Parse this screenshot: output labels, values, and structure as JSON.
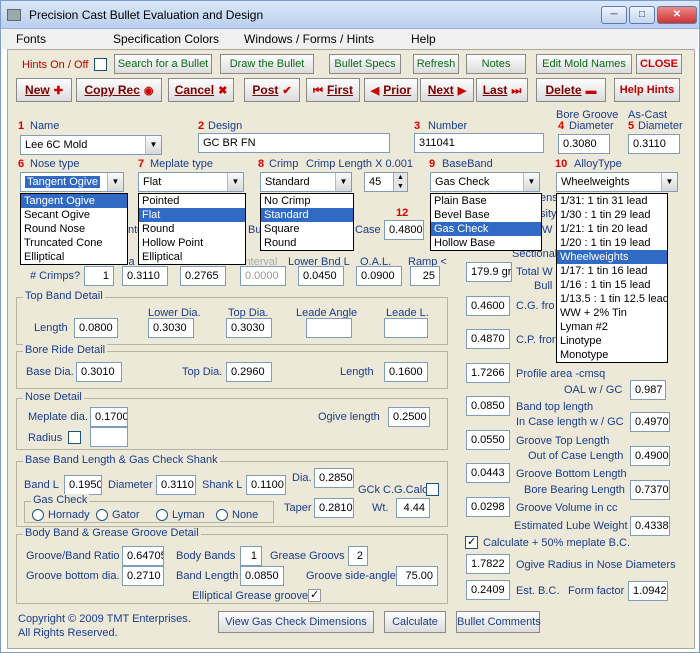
{
  "window": {
    "title": "Precision Cast Bullet Evaluation and Design"
  },
  "menu": [
    "Fonts",
    "Specification Colors",
    "Windows / Forms / Hints",
    "Help"
  ],
  "toolbar1": {
    "hints": "Hints On / Off",
    "search": "Search for a Bullet",
    "draw": "Draw the Bullet",
    "specs": "Bullet Specs",
    "refresh": "Refresh",
    "notes": "Notes",
    "mold": "Edit Mold Names",
    "close": "CLOSE"
  },
  "toolbar2": {
    "new": "New",
    "copy": "Copy Rec",
    "cancel": "Cancel",
    "post": "Post",
    "first": "First",
    "prior": "Prior",
    "next": "Next",
    "last": "Last",
    "delete": "Delete",
    "help": "Help Hints"
  },
  "header": {
    "bore_groove_lbl": "Bore Groove",
    "diameter_lbl": "Diameter",
    "as_cast_lbl": "As-Cast",
    "as_cast_dia_lbl": "Diameter",
    "n1": "1",
    "name_lbl": "Name",
    "name_val": "Lee 6C Mold",
    "n2": "2",
    "design_lbl": "Design",
    "design_val": "GC BR FN",
    "n3": "3",
    "number_lbl": "Number",
    "number_val": "311041",
    "n4": "4",
    "bore_val": "0.3080",
    "n5": "5",
    "ascast_val": "0.3110"
  },
  "row2": {
    "n6": "6",
    "nose_lbl": "Nose type",
    "nose_val": "Tangent Ogive",
    "n7": "7",
    "meplate_lbl": "Meplate type",
    "meplate_val": "Flat",
    "n8": "8",
    "crimp_lbl": "Crimp",
    "crimp_len_lbl": "Crimp Length X 0.001",
    "crimp_val": "Standard",
    "crimp_len_val": "45",
    "n9": "9",
    "baseband_lbl": "BaseBand",
    "baseband_val": "Gas Check",
    "n10": "10",
    "alloy_lbl": "AlloyType",
    "alloy_val": "Wheelweights"
  },
  "dropdowns": {
    "nose": [
      "Tangent Ogive",
      "Secant Ogive",
      "Round Nose",
      "Truncated Cone",
      "Elliptical"
    ],
    "meplate": [
      "Pointed",
      "Flat",
      "Round",
      "Hollow Point",
      "Elliptical"
    ],
    "crimp": [
      "No Crimp",
      "Standard",
      "Square",
      "Round"
    ],
    "baseband": [
      "Plain Base",
      "Bevel Base",
      "Gas Check",
      "Hollow Base"
    ],
    "alloy": [
      "1/31:  1 tin 31 lead",
      "1/30 : 1 tin 29 lead",
      "1/21:  1 tin 20 lead",
      "1/20 : 1 tin 19 lead",
      "Wheelweights",
      "1/17:  1 tin 16 lead",
      "1/16 : 1 tin 15 lead",
      "1/13.5 : 1 tin 12.5 lead",
      "WW + 2% Tin",
      "Lyman #2",
      "Linotype",
      "Monotype"
    ]
  },
  "crimpgroove": {
    "n12": "12",
    "case_lbl": "Case",
    "case_val": "0.4800",
    "b_partial": "Bu",
    "nter_partial": "nte",
    "interval_lbl": "interval",
    "lower_bnd_lbl": "Lower Bnd L",
    "oal_lbl": "O.A.L.",
    "ramp_lbl": "Ramp <",
    "crimps_lbl": "# Crimps?",
    "ia_partial": "ia",
    "crimps_val": "1",
    "dia_val": "0.3110",
    "v2": "0.2765",
    "interval_val": "0.0000",
    "lower_val": "0.0450",
    "oal_val": "0.0900",
    "ramp_val": "25"
  },
  "topband": {
    "title": "Top Band Detail",
    "length_lbl": "Length",
    "length_val": "0.0800",
    "lower_dia_lbl": "Lower Dia.",
    "lower_dia_val": "0.3030",
    "top_dia_lbl": "Top Dia.",
    "top_dia_val": "0.3030",
    "leade_angle_lbl": "Leade Angle",
    "leade_angle_val": "",
    "leade_l_lbl": "Leade L.",
    "leade_l_val": ""
  },
  "boreride": {
    "title": "Bore Ride Detail",
    "base_lbl": "Base Dia.",
    "base_val": "0.3010",
    "top_lbl": "Top Dia.",
    "top_val": "0.2960",
    "length_lbl": "Length",
    "length_val": "0.1600"
  },
  "nose": {
    "title": "Nose Detail",
    "meplate_lbl": "Meplate dia.",
    "meplate_val": "0.1700",
    "radius_lbl": "Radius",
    "radius_val": "",
    "ogive_lbl": "Ogive length",
    "ogive_val": "0.2500"
  },
  "baseband": {
    "title": "Base Band Length & Gas Check Shank",
    "bandl_lbl": "Band L",
    "bandl_val": "0.1950",
    "diameter_lbl": "Diameter",
    "diameter_val": "0.3110",
    "shank_lbl": "Shank L",
    "shank_val": "0.1100",
    "dia_lbl": "Dia.",
    "dia_val": "0.2850",
    "gck_lbl": "GCk C.G.Calc",
    "taper_lbl": "Taper",
    "taper_val": "0.2810",
    "wt_lbl": "Wt.",
    "wt_val": "4.44",
    "gascheck_title": "Gas Check",
    "radios": [
      "Hornady",
      "Gator",
      "Lyman",
      "None"
    ]
  },
  "bodyband": {
    "title": "Body Band & Grease Groove Detail",
    "ratio_lbl": "Groove/Band Ratio",
    "ratio_val": "0.64705",
    "bands_lbl": "Body Bands",
    "bands_val": "1",
    "grooves_lbl": "Grease Groovs",
    "grooves_val": "2",
    "bottom_lbl": "Groove bottom dia.",
    "bottom_val": "0.2710",
    "bandlen_lbl": "Band Length",
    "bandlen_val": "0.0850",
    "side_lbl": "Groove side-angle",
    "side_val": "75.00",
    "elliptical_lbl": "Elliptical Grease groove"
  },
  "right": {
    "ensi_partial": "ensi",
    "sity_partial": "sity",
    "w_partial": "W",
    "sect_lbl": "Sectional Dens",
    "sect_val": "179.9 gr",
    "total_lbl": "Total W",
    "bull_lbl": "Bull",
    "cg_lbl": "C.G. fro",
    "cg_val": "0.4600",
    "cp_lbl": "C.P. fron",
    "cp_val": "0.4870",
    "profile_lbl": "Profile area -cmsq",
    "profile_val": "1.7266",
    "oal_lbl": "OAL w / GC",
    "oal_val": "0.987",
    "topband_lbl": "Band top length",
    "incase_lbl": "In Case length w / GC",
    "topband_val": "0.0850",
    "incase_val": "0.4970",
    "toplen_lbl": "Groove Top Length",
    "outcase_lbl": "Out of Case Length",
    "toplen_val": "0.0550",
    "outcase_val": "0.4900",
    "bottomlen_lbl": "Groove Bottom Length",
    "bearing_lbl": "Bore Bearing Length",
    "bottomlen_val": "0.0443",
    "bearing_val": "0.7370",
    "volume_lbl": "Groove Volume in cc",
    "volume_val": "0.0298",
    "lube_lbl": "Estimated Lube Weight",
    "lube_val": "0.4338",
    "calc_lbl": "Calculate + 50% meplate B.C.",
    "ogive_lbl": "Ogive Radius in Nose Diameters",
    "ogive_val": "1.7822",
    "bc_val": "0.2409",
    "bc_lbl": "Est. B.C.",
    "ff_lbl": "Form factor",
    "ff_val": "1.0942"
  },
  "footer": {
    "copyright1": "Copyright © 2009 TMT Enterprises.",
    "copyright2": "All Rights Reserved.",
    "view_gc": "View Gas Check Dimensions",
    "calculate": "Calculate",
    "comments": "Bullet Comments"
  },
  "colors": {
    "accent": "#316ac5",
    "number_red": "#e00000",
    "label_blue": "#1b3d8f",
    "bg": "#ece9d8"
  }
}
